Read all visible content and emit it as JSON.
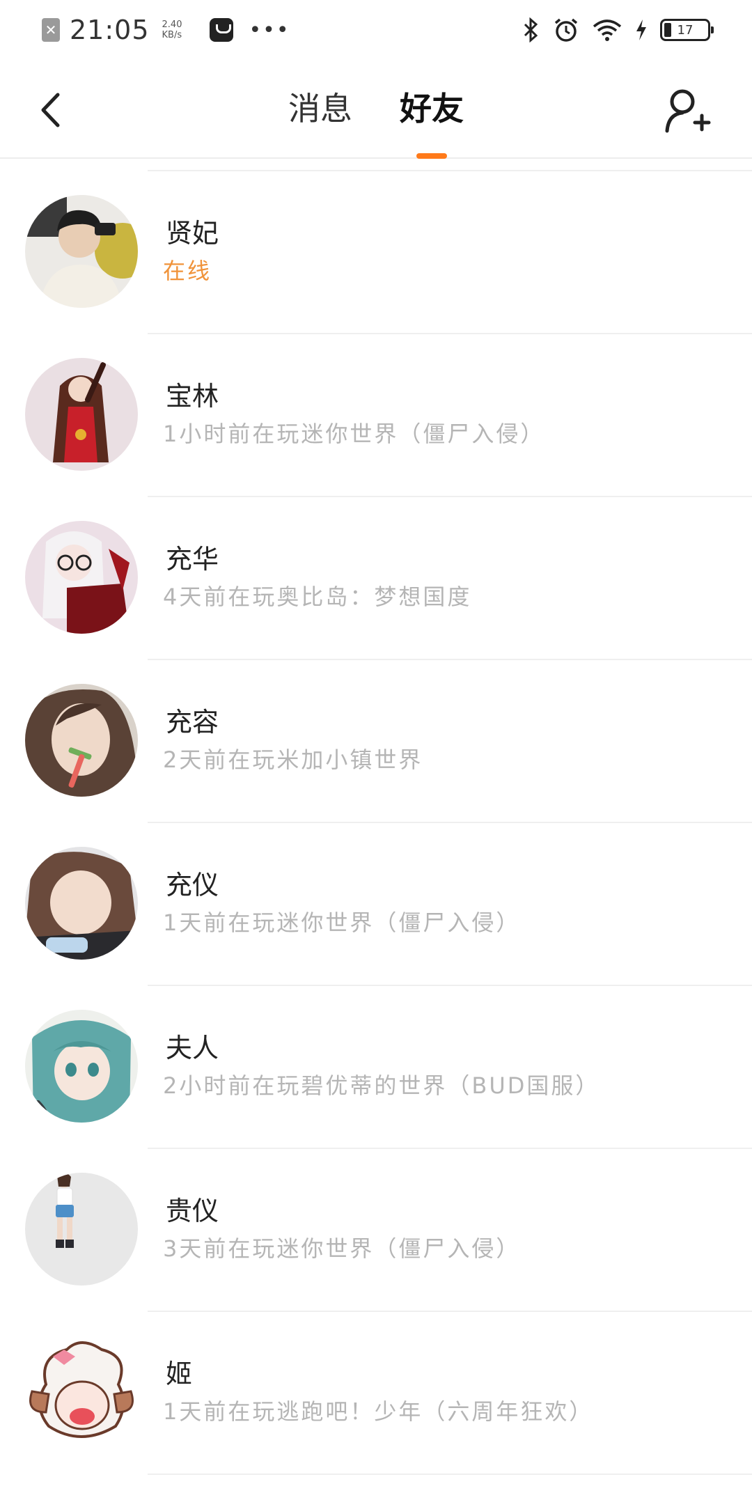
{
  "status_bar": {
    "time": "21:05",
    "net_speed_value": "2.40",
    "net_speed_unit": "KB/s",
    "more": "•••",
    "battery": "17"
  },
  "header": {
    "tabs": [
      {
        "label": "消息",
        "active": false
      },
      {
        "label": "好友",
        "active": true
      }
    ]
  },
  "friends": [
    {
      "name": "贤妃",
      "status": "在线",
      "online": true
    },
    {
      "name": "宝林",
      "status": "1小时前在玩迷你世界（僵尸入侵）",
      "online": false
    },
    {
      "name": "充华",
      "status": "4天前在玩奥比岛：梦想国度",
      "online": false
    },
    {
      "name": "充容",
      "status": "2天前在玩米加小镇世界",
      "online": false
    },
    {
      "name": "充仪",
      "status": "1天前在玩迷你世界（僵尸入侵）",
      "online": false
    },
    {
      "name": "夫人",
      "status": "2小时前在玩碧优蒂的世界（BUD国服）",
      "online": false
    },
    {
      "name": "贵仪",
      "status": "3天前在玩迷你世界（僵尸入侵）",
      "online": false
    },
    {
      "name": "姬",
      "status": "1天前在玩逃跑吧！少年（六周年狂欢）",
      "online": false
    }
  ],
  "colors": {
    "accent": "#ff7a1a",
    "online_status": "#f0933a",
    "secondary_text": "#b5b5b5"
  }
}
